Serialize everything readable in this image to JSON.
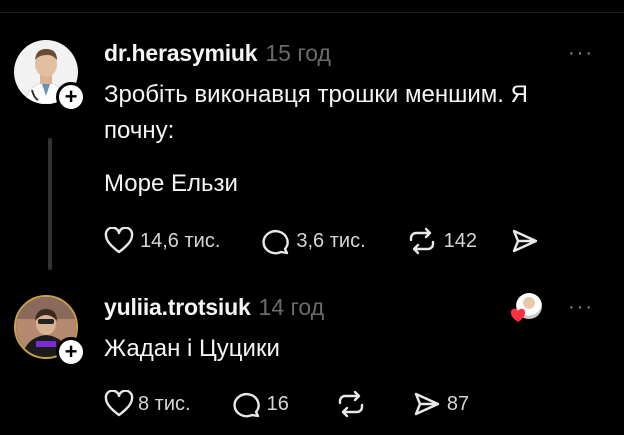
{
  "posts": [
    {
      "username": "dr.herasymiuk",
      "time": "15 год",
      "more": "···",
      "lines": [
        "Зробіть виконавця трошки меншим. Я",
        "почну:"
      ],
      "line2": "Море Ельзи",
      "likes": "14,6 тис.",
      "comments": "3,6 тис.",
      "reposts": "142",
      "shares": ""
    },
    {
      "username": "yuliia.trotsiuk",
      "time": "14 год",
      "more": "···",
      "text": "Жадан і Цуцики",
      "likes": "8 тис.",
      "comments": "16",
      "reposts": "",
      "shares": "87"
    }
  ],
  "colors": {
    "bg": "#000000",
    "text": "#f3f5f7",
    "muted": "#6b6b6b",
    "heart": "#ff3040"
  }
}
